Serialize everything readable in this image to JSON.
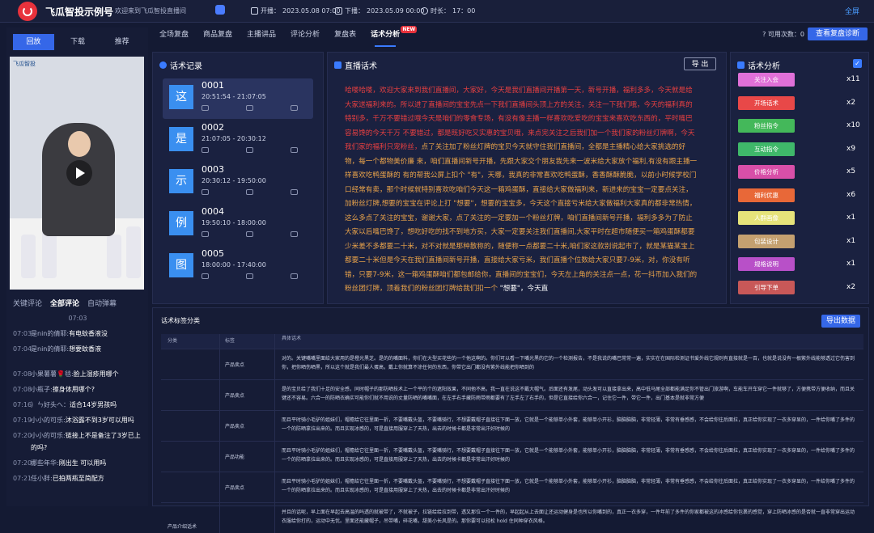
{
  "header": {
    "app_title": "飞瓜智投示例号",
    "welcome": "欢迎来到飞瓜智投直播间",
    "start_label": "开播：",
    "start": "2023.05.08 07:00",
    "end_label": "下播：",
    "end": "2023.05.09 00:00",
    "duration_label": "时长：",
    "duration": "17：00",
    "fullscreen": "全屏"
  },
  "left": {
    "tabs": [
      "回放",
      "下载",
      "推荐"
    ],
    "video_logo": "飞瓜智投",
    "comment_tabs": [
      "关键评论",
      "全部评论",
      "自动弹幕"
    ],
    "comments": [
      {
        "time": "07:03",
        "user": "是nin的倩耶:",
        "text": "有电蚊香液没"
      },
      {
        "time": "07:04",
        "user": "是nin的倩耶:",
        "text": "想要蚊香液"
      },
      {
        "time": "07:08",
        "user": "小果薯薯🌹毯:",
        "text": "脸上湿疹用哪个"
      },
      {
        "time": "07:08",
        "user": "小瓶子:",
        "text": "擦身体用哪个?"
      },
      {
        "time": "07:16",
        "user": "）ㄣ好头へ：",
        "text": "适合14岁男孩吗"
      },
      {
        "time": "07:19",
        "user": "小小的可乐:",
        "text": "沐浴露不到3岁可以用吗"
      },
      {
        "time": "07:20",
        "user": "小小的可乐:",
        "text": "链接上不是备注了3岁已上的吗?"
      },
      {
        "time": "07:20",
        "user": "娜些年华:",
        "text": "刚出生 可以用吗"
      },
      {
        "time": "07:21",
        "user": "任小胖:",
        "text": "已拍两瓶至简配方"
      }
    ],
    "time_divider": "07:03"
  },
  "tabs": {
    "items": [
      "全场复盘",
      "商品复盘",
      "主播讲品",
      "评论分析",
      "复盘表",
      "话术分析"
    ],
    "new_badge": "NEW",
    "avail_label": "可用次数：",
    "avail": "0",
    "action": "查看复盘诊断"
  },
  "records": {
    "title": "话术记录",
    "items": [
      {
        "char": "这",
        "id": "0001",
        "time": "20:51:54 - 21:07:05"
      },
      {
        "char": "是",
        "id": "0002",
        "time": "21:07:05 - 20:30:12"
      },
      {
        "char": "示",
        "id": "0003",
        "time": "20:30:12 - 19:50:00"
      },
      {
        "char": "例",
        "id": "0004",
        "time": "19:50:10 - 18:00:00"
      },
      {
        "char": "图",
        "id": "0005",
        "time": "18:00:00 - 17:40:00"
      }
    ]
  },
  "script": {
    "title": "直播话术",
    "export": "导 出",
    "p1": "哈喽哈喽，欢迎大家来到我们直播间，大家好，今天是我们直播间开播第一天，新号开播，福利多多，今天就是给大家送福利来的。所以进了直播间的宝宝先点一下我们直播间头顶上方的关注，关注一下我们哦，今天的福利真的特别多，千万不要错过哦今天是咱们的零食专场，有没有像主播一样喜欢吃爱吃的宝宝来喜欢吃东西的，平时嘴巴容易馋的今天千万 不要错过，都是既好吃又实惠的宝贝哦，来点完关注之后我们加一个我们家的粉丝灯牌啊，今天我们家的福利只宠粉丝，",
    "p2": "点了关注加了粉丝灯牌的宝贝今天就守住我们直播间，全都是主播精心给大家挑选的好物，每一个都物美价廉 来，咱们直播间新号开播，先跟大家交个朋友我先来一波米给大家放个福利,有没有跟主播一样喜欢吃鸭蛋酥的 有的帮我公屏上扣个 \"有\"，天哪，我真的非常喜欢吃鸭蛋酥，香香酥酥脆脆，以前小时候学校门口经常有卖，那个时候就特别喜欢吃咱们今天这一箱鸡蛋酥，直接给大家做福利来，新进来的宝宝一定要点关注，加粉丝灯牌,想要的宝宝在评论上打 \"想要\"，想要的宝宝多，今天这个直接亏米给大家做福利大家真的都非常热情，这么多点了关注的宝宝，谢谢大家，点了关注的一定要加一个粉丝灯牌，咱们直播间新号开播，福利多多为了防止大家以后嘴巴馋了，想吃好吃的找不到地方买，大家一定要关注我们直播间,大家平时在超市随便买一箱鸡蛋酥都要少米差不多都要二十米，对不对就是那种散称的，随便称一点都要二十米,咱们家这款别说起市了，就是某猫某宝上都要二十米但是今天在我们直播间新号开播，直接给大家亏米，我们直播个位数给大家只要7-9米，对，你没有听错，只要7-9米，这一箱鸡蛋酥咱们都包邮给你，直播间的宝宝们，今天左上角的关注点一点，花一抖币加入我们的粉丝团灯牌，顶着我们的粉丝团灯牌给我们扣一个 ",
    "p3": "\"想要\"，今天直"
  },
  "tags": {
    "title": "话术分析",
    "items": [
      {
        "label": "关注入会",
        "count": "x11",
        "color": "#e070d8"
      },
      {
        "label": "开场话术",
        "count": "x2",
        "color": "#e84848"
      },
      {
        "label": "粉丝指令",
        "count": "x10",
        "color": "#44b85a"
      },
      {
        "label": "互动指令",
        "count": "x9",
        "color": "#3fb86a"
      },
      {
        "label": "价格分析",
        "count": "x5",
        "color": "#d84fa8"
      },
      {
        "label": "福利优惠",
        "count": "x6",
        "color": "#e86838"
      },
      {
        "label": "人群画像",
        "count": "x1",
        "color": "#e6e37a"
      },
      {
        "label": "包装设计",
        "count": "x1",
        "color": "#c4a070"
      },
      {
        "label": "规格说明",
        "count": "x1",
        "color": "#b850c8"
      },
      {
        "label": "引导下单",
        "count": "x2",
        "color": "#c85858"
      }
    ]
  },
  "classify": {
    "title": "话术标签分类",
    "export": "导出数据",
    "headers": [
      "分类",
      "标签",
      "具体话术"
    ],
    "rows": [
      {
        "cat": "",
        "tag": "产品卖点",
        "text": "对的。关键嘴嘴里面给大家用的是橙光黑芝。是的的嘴面料，你们在大型买花些的一个他这啊的。你们可以看一下嘴光黑的它的一个检测报告，不是我说的嘴巴常常一遍，实实在在国际检测证书爱外线它规则有直接就是一百，也就是说没有一根紫外线能够透过它伤害到你，把你晒伤晒黑，所以这个就是我们最人蛋高，戴上你就算不涂任何的东西，你带它出门都没有紫外线能把你晒到的"
      },
      {
        "cat": "",
        "tag": "产品卖点",
        "text": "是的宝贝给了我们十足的安全感，同时帽子的那防晒技术上一个平的个的遮阳效果，不同他不高，我一直在说这不戴大帽气。后面还有发尾，动头发可以直接拿出来，高中低马尾全部都能满足你不管出门旅游啊，车能车开车穿它一件就够了，方便携带方便收纳，而且关键还不容易。六合一的防晒衣确实可能你们就不用说的丈量防晒的嘴嘴面，在左手右手藏防雨带雨都要有了左手左了右手的，但是它直接给你六合一，记住它一件，带它一件，出门基本是就非常方便"
      },
      {
        "cat": "",
        "tag": "产品卖点",
        "text": "而且平时骑小毛驴的姐妹们，帽檐给它往里面一折，不要嘴戴头盔，不要嘴骑行，不想要戴帽子直接往下面一放，它就是一个能够单小外套，能够单小开衫，脑脑脑脑，非常轻薄，非常有垂感感，不会给你往后面拉，真正给你实现了一衣多穿显的，一件给你嘴了多件的一个的防晒拿拉出来的。而且实现冰感的，可是直接用服穿上了天热，出去的时候卡都是非常出汗好时候的"
      },
      {
        "cat": "",
        "tag": "产品功能",
        "text": "而且平时骑小毛驴的姐妹们，帽檐给它往里面一折，不要嘴戴头盔，不要嘴骑行，不想要戴帽子直接往下面一放，它就是一个能够单小外套，能够单小开衫，脑脑脑脑，非常轻薄，非常有垂感感，不会给你往后面拉，真正给你实现了一衣多穿显的，一件给你嘴了多件的一个的防晒拿拉出来的。而且实现冰感的，可是直接用服穿上了天热，出去的时候卡都是非常出汗好时候的"
      },
      {
        "cat": "",
        "tag": "产品卖点",
        "text": "而且平时骑小毛驴的姐妹们，帽檐给它往里面一折，不要嘴戴头盔，不要嘴骑行，不想要戴帽子直接往下面一放，它就是一个能够单小外套，能够单小开衫，脑脑脑脑，非常轻薄，非常有垂感感，不会给你往后面拉，真正给你实现了一衣多穿显的，一件给你嘴了多件的一个的防晒拿拉出来的。而且实现冰感的，可是直接用服穿上了天热，出去的时候卡都是非常出汗好时候的"
      },
      {
        "cat": "产品介绍话术",
        "tag": "",
        "text": "并且的话呢，早上面在早起去高温的吗透的就被带了，不就被子，拉链给给拉到带，透又那位一个一件的，早起起从上去面让还运动健身是也所以你嘴到的，真正一衣多穿，一件年前了多件的你家都被这的冰感给你包裹的感觉，穿上防晒冰感的是否就一直非常穿出运动衣服给你打的，运动中无忧。里面还能藏帽子，吊带嘴，碎花嘴，甜美小长风是的。那你要可以轻松 hold 住同种穿衣风格。"
      }
    ]
  }
}
